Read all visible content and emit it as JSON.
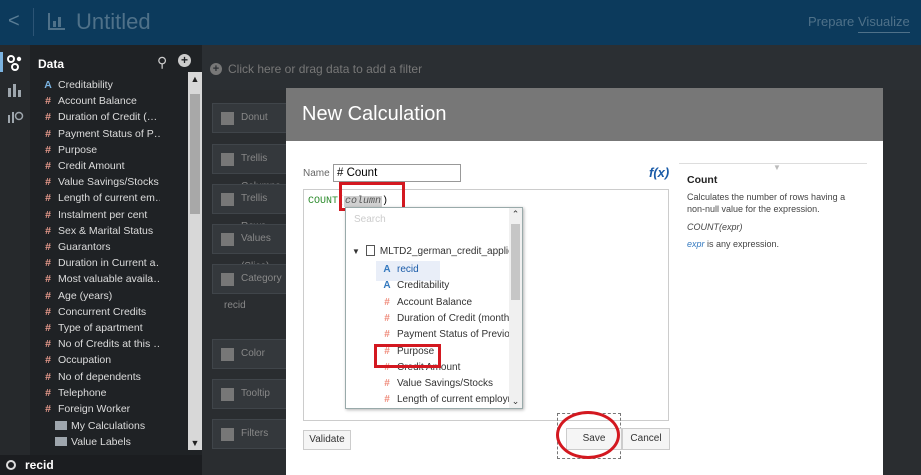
{
  "header": {
    "back_glyph": "<",
    "title": "Untitled",
    "prepare_label": "Prepare",
    "visualize_label": "Visualize"
  },
  "data_panel": {
    "title": "Data",
    "items": [
      {
        "label": "Creditability",
        "type": "attribute"
      },
      {
        "label": "Account Balance",
        "type": "measure"
      },
      {
        "label": "Duration of Credit (…",
        "type": "measure"
      },
      {
        "label": "Payment Status of P…",
        "type": "measure"
      },
      {
        "label": "Purpose",
        "type": "measure"
      },
      {
        "label": "Credit Amount",
        "type": "measure"
      },
      {
        "label": "Value Savings/Stocks",
        "type": "measure"
      },
      {
        "label": "Length of current em…",
        "type": "measure"
      },
      {
        "label": "Instalment per cent",
        "type": "measure"
      },
      {
        "label": "Sex & Marital Status",
        "type": "measure"
      },
      {
        "label": "Guarantors",
        "type": "measure"
      },
      {
        "label": "Duration in Current a…",
        "type": "measure"
      },
      {
        "label": "Most valuable availa…",
        "type": "measure"
      },
      {
        "label": "Age (years)",
        "type": "measure"
      },
      {
        "label": "Concurrent Credits",
        "type": "measure"
      },
      {
        "label": "Type of apartment",
        "type": "measure"
      },
      {
        "label": "No of Credits at this …",
        "type": "measure"
      },
      {
        "label": "Occupation",
        "type": "measure"
      },
      {
        "label": "No of dependents",
        "type": "measure"
      },
      {
        "label": "Telephone",
        "type": "measure"
      },
      {
        "label": "Foreign Worker",
        "type": "measure"
      }
    ],
    "folders": [
      {
        "label": "My Calculations"
      },
      {
        "label": "Value Labels"
      }
    ],
    "bottom_field": "recid"
  },
  "filter_bar": {
    "placeholder": "Click here or drag data to add a filter"
  },
  "grammar": {
    "rows": [
      "Donut",
      "Trellis Columns",
      "Trellis Rows",
      "Values (Slice)",
      "Category",
      "Color",
      "Tooltip",
      "Filters"
    ],
    "category_value": "recid"
  },
  "modal": {
    "title": "New Calculation",
    "name_label": "Name",
    "name_value": "# Count",
    "fx_label": "f(x)",
    "expression": {
      "function": "COUNT",
      "open": "(",
      "placeholder": "column",
      "close": ")"
    },
    "dropdown": {
      "search_placeholder": "Search",
      "root": "MLTD2_german_credit_applic",
      "items": [
        {
          "label": "recid",
          "type": "attribute",
          "selected": true
        },
        {
          "label": "Creditability",
          "type": "attribute"
        },
        {
          "label": "Account Balance",
          "type": "measure"
        },
        {
          "label": "Duration of Credit (month)",
          "type": "measure"
        },
        {
          "label": "Payment Status of Previou",
          "type": "measure"
        },
        {
          "label": "Purpose",
          "type": "measure"
        },
        {
          "label": "Credit Amount",
          "type": "measure"
        },
        {
          "label": "Value Savings/Stocks",
          "type": "measure"
        },
        {
          "label": "Length of current employm",
          "type": "measure"
        }
      ]
    },
    "buttons": {
      "validate": "Validate",
      "save": "Save",
      "cancel": "Cancel"
    },
    "help": {
      "title": "Count",
      "description": "Calculates the number of rows having a non-null value for the expression.",
      "signature": "COUNT(expr)",
      "expr_keyword": "expr",
      "expr_text": " is any expression."
    }
  },
  "colors": {
    "header_bg": "#0c3a5c",
    "annotation_red": "#d31820",
    "measure_icon": "#e79a8c",
    "attribute_icon": "#7bb3e0"
  }
}
